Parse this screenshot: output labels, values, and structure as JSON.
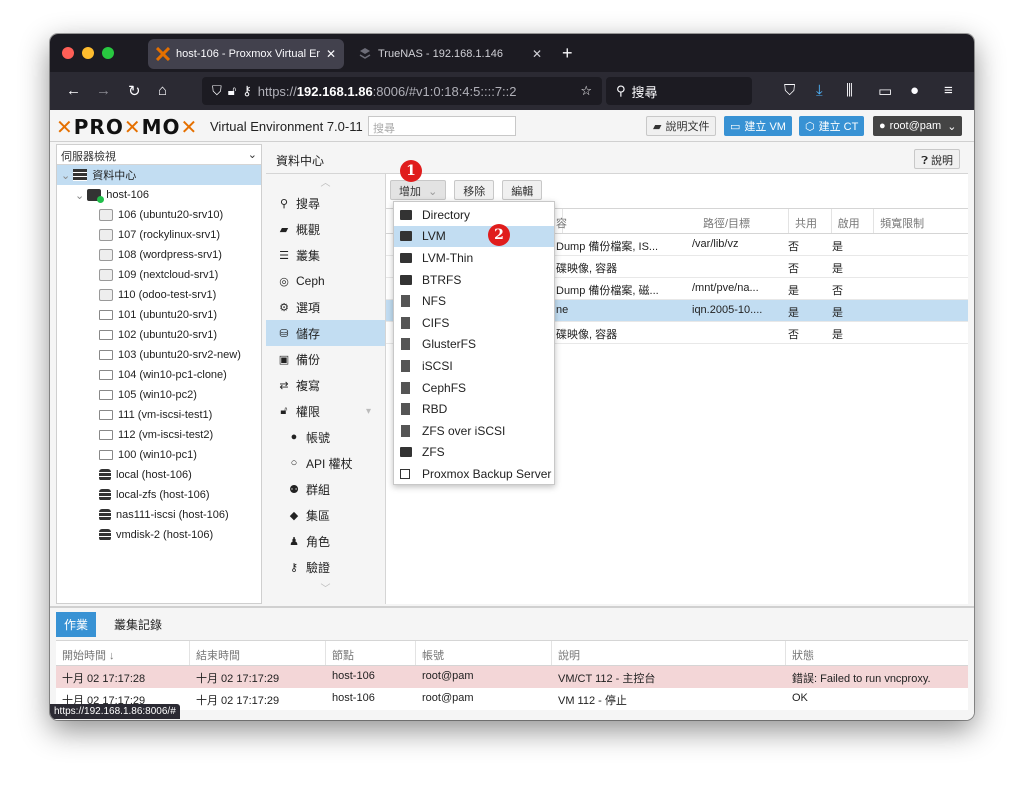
{
  "browser": {
    "tabs": [
      {
        "title": "host-106 - Proxmox Virtual Envi",
        "active": true
      },
      {
        "title": "TrueNAS - 192.168.1.146",
        "active": false
      }
    ],
    "url_prefix": "https://",
    "url_host": "192.168.1.86",
    "url_rest": ":8006/#v1:0:18:4:5::::7::2",
    "search_placeholder": "搜尋",
    "status_url": "https://192.168.1.86:8006/#"
  },
  "header": {
    "logo_pro": "PRO",
    "logo_mo": "MO",
    "version": "Virtual Environment 7.0-11",
    "search_placeholder": "搜尋",
    "docs_label": "說明文件",
    "create_vm_label": "建立 VM",
    "create_ct_label": "建立 CT",
    "user_label": "root@pam"
  },
  "tree": {
    "view_label": "伺服器檢視",
    "datacenter": "資料中心",
    "host": "host-106",
    "items": [
      {
        "label": "106 (ubuntu20-srv10)",
        "type": "ct"
      },
      {
        "label": "107 (rockylinux-srv1)",
        "type": "ct"
      },
      {
        "label": "108 (wordpress-srv1)",
        "type": "ct"
      },
      {
        "label": "109 (nextcloud-srv1)",
        "type": "ct"
      },
      {
        "label": "110 (odoo-test-srv1)",
        "type": "ct"
      },
      {
        "label": "101 (ubuntu20-srv1)",
        "type": "vm"
      },
      {
        "label": "102 (ubuntu20-srv1)",
        "type": "vm"
      },
      {
        "label": "103 (ubuntu20-srv2-new)",
        "type": "vm"
      },
      {
        "label": "104 (win10-pc1-clone)",
        "type": "vm"
      },
      {
        "label": "105 (win10-pc2)",
        "type": "vm"
      },
      {
        "label": "111 (vm-iscsi-test1)",
        "type": "vm"
      },
      {
        "label": "112 (vm-iscsi-test2)",
        "type": "vm"
      },
      {
        "label": "100 (win10-pc1)",
        "type": "vm"
      },
      {
        "label": "local (host-106)",
        "type": "storage"
      },
      {
        "label": "local-zfs (host-106)",
        "type": "storage"
      },
      {
        "label": "nas111-iscsi (host-106)",
        "type": "storage"
      },
      {
        "label": "vmdisk-2 (host-106)",
        "type": "storage"
      }
    ]
  },
  "content": {
    "title": "資料中心",
    "help_label": "說明"
  },
  "nav": {
    "items": [
      {
        "label": "搜尋",
        "icon": "search-icon"
      },
      {
        "label": "概觀",
        "icon": "book-icon"
      },
      {
        "label": "叢集",
        "icon": "server-icon"
      },
      {
        "label": "Ceph",
        "icon": "ceph-icon"
      },
      {
        "label": "選項",
        "icon": "gear-icon"
      },
      {
        "label": "儲存",
        "icon": "database-icon"
      },
      {
        "label": "備份",
        "icon": "floppy-icon"
      },
      {
        "label": "複寫",
        "icon": "retweet-icon"
      },
      {
        "label": "權限",
        "icon": "unlock-icon"
      },
      {
        "label": "帳號",
        "icon": "user-icon"
      },
      {
        "label": "API 權杖",
        "icon": "user-outline-icon"
      },
      {
        "label": "群組",
        "icon": "users-icon"
      },
      {
        "label": "集區",
        "icon": "tags-icon"
      },
      {
        "label": "角色",
        "icon": "male-icon"
      },
      {
        "label": "驗證",
        "icon": "key-icon"
      }
    ]
  },
  "storage": {
    "toolbar": {
      "add": "增加",
      "remove": "移除",
      "edit": "編輯"
    },
    "columns": [
      "容",
      "路徑/目標",
      "共用",
      "啟用",
      "頻寬限制"
    ],
    "rows": [
      {
        "content": "Dump 備份檔案, IS...",
        "path": "/var/lib/vz",
        "shared": "否",
        "enabled": "是"
      },
      {
        "content": "碟映像, 容器",
        "path": "",
        "shared": "否",
        "enabled": "是"
      },
      {
        "content": "Dump 備份檔案, 磁...",
        "path": "/mnt/pve/na...",
        "shared": "是",
        "enabled": "否"
      },
      {
        "content": "ne",
        "path": "iqn.2005-10....",
        "shared": "是",
        "enabled": "是"
      },
      {
        "content": "碟映像, 容器",
        "path": "",
        "shared": "否",
        "enabled": "是"
      }
    ]
  },
  "add_menu": {
    "items": [
      {
        "label": "Directory",
        "icon": "folder"
      },
      {
        "label": "LVM",
        "icon": "folder"
      },
      {
        "label": "LVM-Thin",
        "icon": "folder"
      },
      {
        "label": "BTRFS",
        "icon": "folder"
      },
      {
        "label": "NFS",
        "icon": "server"
      },
      {
        "label": "CIFS",
        "icon": "server"
      },
      {
        "label": "GlusterFS",
        "icon": "server"
      },
      {
        "label": "iSCSI",
        "icon": "server"
      },
      {
        "label": "CephFS",
        "icon": "server"
      },
      {
        "label": "RBD",
        "icon": "server"
      },
      {
        "label": "ZFS over iSCSI",
        "icon": "server"
      },
      {
        "label": "ZFS",
        "icon": "folder"
      },
      {
        "label": "Proxmox Backup Server",
        "icon": "disk"
      }
    ]
  },
  "markers": {
    "one": "1",
    "two": "2"
  },
  "log": {
    "tabs": [
      "作業",
      "叢集記錄"
    ],
    "columns": [
      "開始時間 ↓",
      "結束時間",
      "節點",
      "帳號",
      "說明",
      "狀態"
    ],
    "rows": [
      {
        "start": "十月 02 17:17:28",
        "end": "十月 02 17:17:29",
        "node": "host-106",
        "user": "root@pam",
        "desc": "VM/CT 112 - 主控台",
        "status": "錯誤: Failed to run vncproxy."
      },
      {
        "start": "十月 02 17:17:29",
        "end": "十月 02 17:17:29",
        "node": "host-106",
        "user": "root@pam",
        "desc": "VM 112 - 停止",
        "status": "OK"
      }
    ]
  },
  "colors": {
    "accent": "#3892d4",
    "selection": "#c2ddf2",
    "error_row": "#f3d6d7",
    "logo_orange": "#e57000",
    "marker_red": "#e01d1d"
  }
}
